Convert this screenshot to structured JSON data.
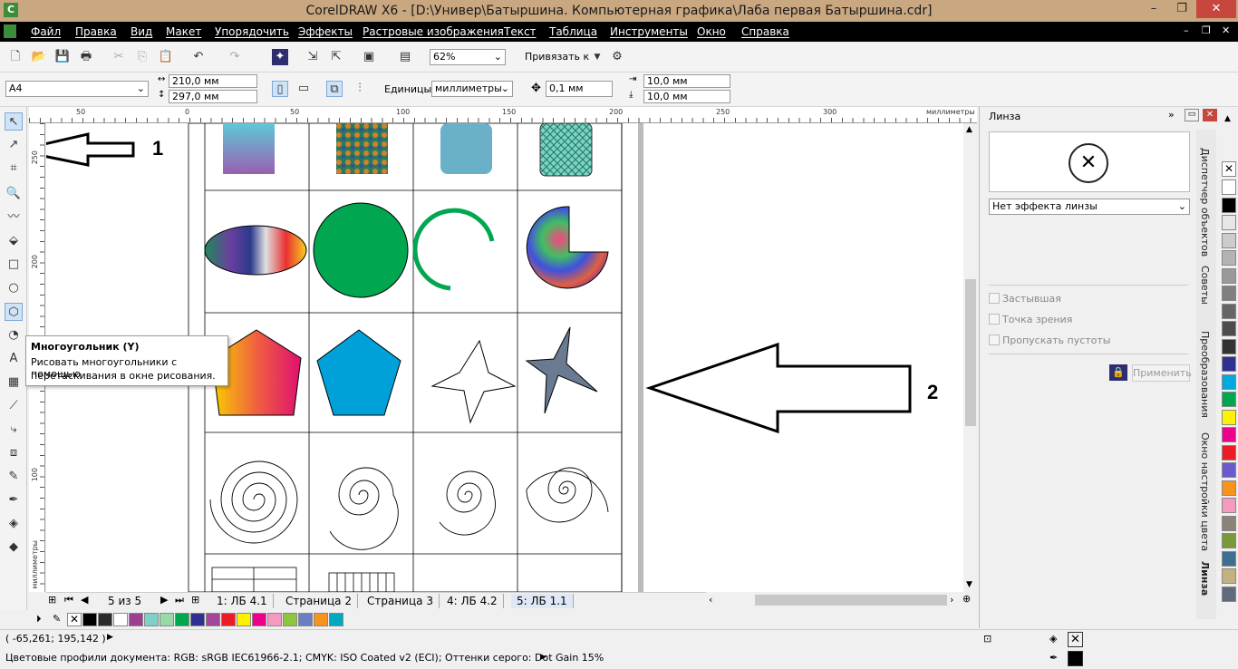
{
  "title": "CorelDRAW X6 - [D:\\Универ\\Батыршина. Компьютерная графика\\Лаба первая Батыршина.cdr]",
  "window_controls": {
    "minimize": "–",
    "restore": "❐",
    "close": "✕"
  },
  "menu": [
    "Файл",
    "Правка",
    "Вид",
    "Макет",
    "Упорядочить",
    "Эффекты",
    "Растровые изображения",
    "Текст",
    "Таблица",
    "Инструменты",
    "Окно",
    "Справка"
  ],
  "toolbar": {
    "zoom": "62%",
    "snap": "Привязать к"
  },
  "propbar": {
    "page_size": "A4",
    "width": "210,0 мм",
    "height": "297,0 мм",
    "units_label": "Единицы:",
    "units": "миллиметры",
    "nudge": "0,1 мм",
    "dup_x": "10,0 мм",
    "dup_y": "10,0 мм"
  },
  "ruler_top": {
    "labels": [
      "50",
      "0",
      "50",
      "100",
      "150",
      "200",
      "250",
      "300"
    ],
    "units": "миллиметры"
  },
  "ruler_left": {
    "labels": [
      "250",
      "200",
      "150",
      "100"
    ],
    "units": "миллиметры"
  },
  "tooltip": {
    "title": "Многоугольник (Y)",
    "line1": "Рисовать многоугольники с помощью",
    "line2": "перетаскивания в окне рисования."
  },
  "annotations": {
    "arrow1": "1",
    "arrow2": "2"
  },
  "page_nav": {
    "counter": "5 из 5",
    "tabs": [
      "1: ЛБ 4.1",
      "Страница 2",
      "Страница 3",
      "4: ЛБ 4.2",
      "5: ЛБ 1.1"
    ],
    "active": 4
  },
  "docker": {
    "title": "Линза",
    "effect": "Нет эффекта линзы",
    "options": [
      "Застывшая",
      "Точка зрения",
      "Пропускать пустоты"
    ],
    "apply": "Применить",
    "side_tabs": [
      "Диспетчер объектов",
      "Советы",
      "Преобразования",
      "Окно настройки цвета",
      "Линза"
    ]
  },
  "status": {
    "coords": "( -65,261; 195,142 )",
    "profiles": "Цветовые профили документа: RGB: sRGB IEC61966-2.1; CMYK: ISO Coated v2 (ECI); Оттенки серого: Dot Gain 15%"
  },
  "palette_bottom": [
    "#000000",
    "#2b2b2b",
    "#ffffff",
    "#9c3f8f",
    "#7fd1c8",
    "#98d9a8",
    "#00a650",
    "#2e3192",
    "#a3479b",
    "#ec1c24",
    "#fff200",
    "#ed008c",
    "#f49ac1",
    "#8cc63f",
    "#6a7fc1",
    "#f7941d",
    "#00a9c0"
  ],
  "palette_right": [
    "#ffffff",
    "#000000",
    "#e6e6e6",
    "#cccccc",
    "#b3b3b3",
    "#999999",
    "#808080",
    "#666666",
    "#4d4d4d",
    "#333333",
    "#2e3192",
    "#00a9e0",
    "#00a650",
    "#fff200",
    "#ed008c",
    "#ec1c24",
    "#6a5acd",
    "#f7941d",
    "#f49ac1",
    "#8b8378",
    "#7a9a3a",
    "#3f6f8f",
    "#c2b280",
    "#5f6b7a"
  ]
}
